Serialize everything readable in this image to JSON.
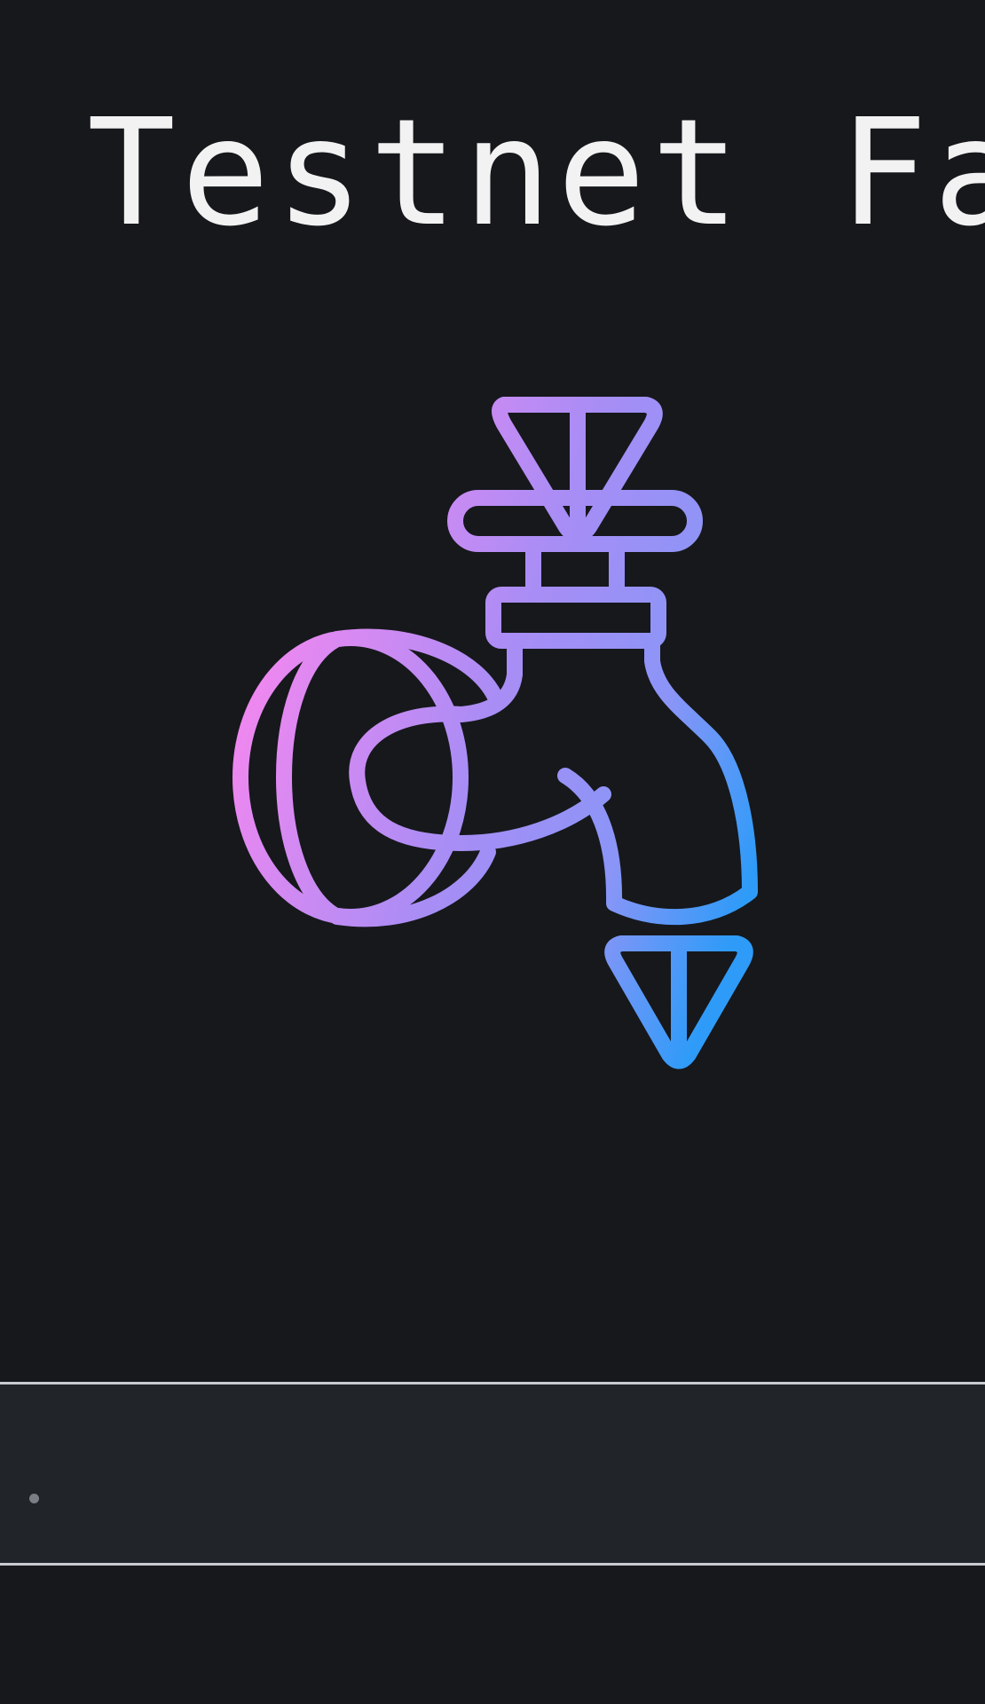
{
  "header": {
    "title": "Testnet Fa"
  },
  "hero": {
    "icon": "faucet-icon",
    "gradient_colors": [
      "#f287f0",
      "#a88df5",
      "#8b95f7",
      "#2f9bf8"
    ]
  },
  "address_field": {
    "value": "",
    "placeholder": ""
  },
  "colors": {
    "background": "#16181c",
    "panel": "#212428",
    "panel_border": "#c8cbd0",
    "title_text": "#f2f2f2"
  }
}
